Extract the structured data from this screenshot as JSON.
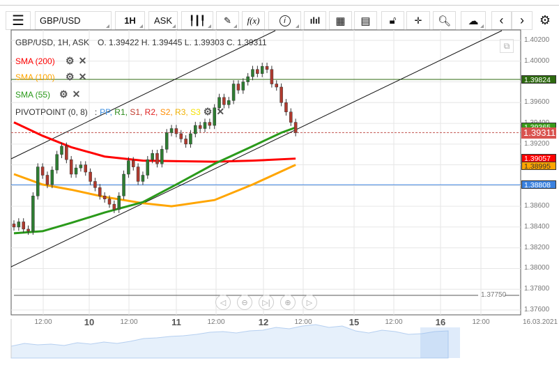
{
  "toolbar": {
    "symbol": "GBP/USD",
    "timeframe": "1H",
    "price_type": "ASK",
    "fx_label": "f(x)",
    "icons": [
      "menu-icon",
      "candles-icon",
      "pencil-icon",
      "function-icon",
      "info-icon",
      "bar-chart-icon",
      "calendar-icon",
      "report-icon",
      "lock-icon",
      "crosshair-icon",
      "zoom-icon",
      "cloud-upload-icon",
      "chevron-left-icon",
      "chevron-right-icon",
      "gear-icon"
    ]
  },
  "header": {
    "title": "GBP/USD, 1H, ASK",
    "ohlc": "O. 1.39422 H. 1.39445 L. 1.39303 C. 1.39311"
  },
  "indicators": [
    {
      "label": "SMA (200)",
      "color": "#ff0000"
    },
    {
      "label": "SMA (100)",
      "color": "#ffa500"
    },
    {
      "label": "SMA (55)",
      "color": "#2a9a1a"
    }
  ],
  "pivot": {
    "label": "PIVOTPOINT (0, 8)",
    "sep": ":",
    "items": [
      {
        "t": "PP",
        "c": "#3b8de0"
      },
      {
        "t": "R1",
        "c": "#2a8a1a"
      },
      {
        "t": "S1",
        "c": "#c0392b"
      },
      {
        "t": "R2",
        "c": "#e02020"
      },
      {
        "t": "S2",
        "c": "#ff8c00"
      },
      {
        "t": "R3",
        "c": "#f0b000"
      },
      {
        "t": "S3",
        "c": "#f5e000"
      }
    ]
  },
  "price_axis": [
    "1.40200",
    "1.40000",
    "1.39600",
    "1.39400",
    "1.39200",
    "1.38600",
    "1.38400",
    "1.38200",
    "1.38000",
    "1.37800",
    "1.37600"
  ],
  "price_tags": [
    {
      "value": "1.39824",
      "color": "#2d6a0f"
    },
    {
      "value": "1.39365",
      "color": "#3a9a1a"
    },
    {
      "value": "1.39311",
      "color": "#d9534f"
    },
    {
      "value": "1.39057",
      "color": "#ff0000"
    },
    {
      "value": "1.38995",
      "color": "#ffa500"
    },
    {
      "value": "1.38808",
      "color": "#3b82e0"
    }
  ],
  "horizontal_lines": {
    "green": 1.39824,
    "blue": 1.38808,
    "current": 1.39311,
    "bottom": 1.3775
  },
  "bottom_label": "1.37750",
  "time_axis": [
    {
      "t": "12:00"
    },
    {
      "t": "10",
      "b": true
    },
    {
      "t": "12:00"
    },
    {
      "t": "11",
      "b": true
    },
    {
      "t": "12:00"
    },
    {
      "t": "12",
      "b": true
    },
    {
      "t": "12:00"
    },
    {
      "t": "15",
      "b": true
    },
    {
      "t": "12:00"
    },
    {
      "t": "16",
      "b": true
    },
    {
      "t": "12:00"
    },
    {
      "t": "16.03.2021"
    }
  ],
  "closes": [
    1.384,
    1.3845,
    1.3838,
    1.3836,
    1.387,
    1.3898,
    1.389,
    1.3881,
    1.3895,
    1.391,
    1.3918,
    1.3905,
    1.3891,
    1.3897,
    1.39,
    1.3893,
    1.3884,
    1.3878,
    1.387,
    1.3867,
    1.3862,
    1.3857,
    1.387,
    1.3891,
    1.3904,
    1.3898,
    1.3884,
    1.389,
    1.3905,
    1.3911,
    1.3901,
    1.3915,
    1.3931,
    1.3935,
    1.393,
    1.3925,
    1.392,
    1.393,
    1.3938,
    1.3935,
    1.3941,
    1.3938,
    1.3955,
    1.3965,
    1.3958,
    1.3962,
    1.3978,
    1.3972,
    1.398,
    1.3985,
    1.3992,
    1.3988,
    1.3995,
    1.3992,
    1.3978,
    1.3975,
    1.396,
    1.3951,
    1.3941,
    1.3931
  ],
  "sma200": [
    [
      0,
      1.3941
    ],
    [
      6,
      1.3928
    ],
    [
      12,
      1.3917
    ],
    [
      19,
      1.3908
    ],
    [
      27,
      1.3904
    ],
    [
      42,
      1.3903
    ],
    [
      50,
      1.3904
    ],
    [
      59,
      1.3906
    ]
  ],
  "sma100": [
    [
      0,
      1.3891
    ],
    [
      6,
      1.3881
    ],
    [
      12,
      1.3876
    ],
    [
      19,
      1.3869
    ],
    [
      27,
      1.3863
    ],
    [
      33,
      1.386
    ],
    [
      42,
      1.3866
    ],
    [
      50,
      1.3881
    ],
    [
      59,
      1.39
    ]
  ],
  "sma55": [
    [
      0,
      1.3834
    ],
    [
      6,
      1.3836
    ],
    [
      12,
      1.3844
    ],
    [
      19,
      1.3854
    ],
    [
      27,
      1.3864
    ],
    [
      34,
      1.3881
    ],
    [
      42,
      1.3901
    ],
    [
      50,
      1.3918
    ],
    [
      56,
      1.3931
    ],
    [
      59,
      1.3936
    ]
  ]
}
